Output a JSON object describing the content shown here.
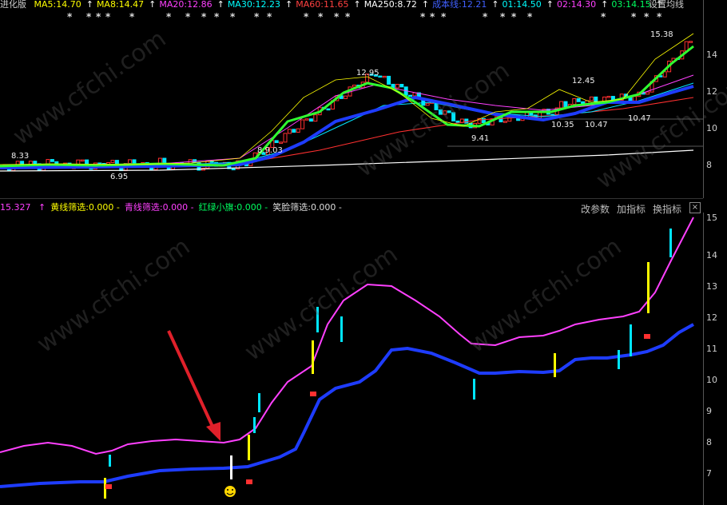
{
  "top_header": {
    "version_label": "进化版",
    "ma_items": [
      {
        "label": "MA5:14.70",
        "color": "#ffff00",
        "arrow": "↑"
      },
      {
        "label": "MA8:14.47",
        "color": "#ffff00",
        "arrow": "↑"
      },
      {
        "label": "MA20:12.86",
        "color": "#ff40ff",
        "arrow": "↑"
      },
      {
        "label": "MA30:12.23",
        "color": "#00ffff",
        "arrow": "↑"
      },
      {
        "label": "MA60:11.65",
        "color": "#ff4040",
        "arrow": "↑"
      },
      {
        "label": "MA250:8.72",
        "color": "#ffffff",
        "arrow": "↑"
      },
      {
        "label": "成本线:12.21",
        "color": "#4060ff",
        "arrow": "↑"
      },
      {
        "label": "01:14.50",
        "color": "#00ffff",
        "arrow": "↑"
      },
      {
        "label": "02:14.30",
        "color": "#ff40ff",
        "arrow": "↑"
      },
      {
        "label": "03:14.15",
        "color": "#00ff60",
        "arrow": "↑"
      }
    ],
    "settings_label": "设置均线"
  },
  "price_labels": [
    "8.33",
    "6.95",
    "8.9.03",
    "12.95",
    "9.41",
    "12.45",
    "10.35",
    "10.47",
    "10.47",
    "15.38"
  ],
  "price_axis_ticks": [
    "14",
    "12",
    "10",
    "8"
  ],
  "indicator_header": {
    "value": "15.327",
    "items": [
      {
        "label": "黄线筛选:0.000",
        "color": "#ffff00"
      },
      {
        "label": "青线筛选:0.000",
        "color": "#ff40ff"
      },
      {
        "label": "红绿小旗:0.000",
        "color": "#00ff60"
      },
      {
        "label": "笑脸筛选:0.000",
        "color": "#dddddd"
      }
    ],
    "buttons": [
      "改参数",
      "加指标",
      "换指标"
    ],
    "close_icon": "×"
  },
  "indicator_axis_ticks": [
    "15",
    "14",
    "13",
    "12",
    "11",
    "10",
    "9",
    "8",
    "7"
  ],
  "watermark": "www.cfchi.com",
  "colors": {
    "background": "#000000",
    "magenta": "#ff40ff",
    "blue": "#1e3cff",
    "green": "#30ff30",
    "yellow": "#ffff00",
    "cyan": "#00e5ff",
    "red": "#ff3030",
    "arrow_annotation": "#e0202a"
  }
}
